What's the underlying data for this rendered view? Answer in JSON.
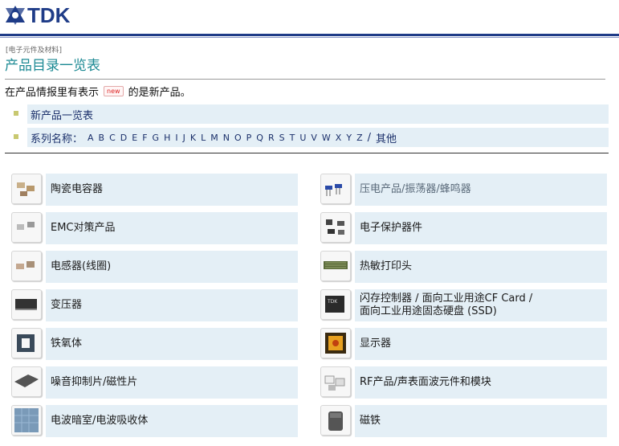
{
  "header": {
    "logo_text": "TDK"
  },
  "breadcrumb": "[电子元件及材料]",
  "page_title": "产品目录一览表",
  "note": {
    "prefix": "在产品情报里有表示",
    "badge": "new",
    "suffix": "的是新产品。"
  },
  "links": {
    "new_list": "新产品一览表",
    "series_label": "系列名称：",
    "letters": [
      "A",
      "B",
      "C",
      "D",
      "E",
      "F",
      "G",
      "H",
      "I",
      "J",
      "K",
      "L",
      "M",
      "N",
      "O",
      "P",
      "Q",
      "R",
      "S",
      "T",
      "U",
      "V",
      "W",
      "X",
      "Y",
      "Z"
    ],
    "others_sep": "/",
    "others": "其他"
  },
  "categories_left": [
    {
      "label": "陶瓷电容器",
      "icon": "ceramic-capacitor-icon"
    },
    {
      "label": "EMC对策产品",
      "icon": "emc-component-icon"
    },
    {
      "label": "电感器(线圈)",
      "icon": "inductor-icon"
    },
    {
      "label": "变压器",
      "icon": "transformer-icon"
    },
    {
      "label": "铁氧体",
      "icon": "ferrite-core-icon"
    },
    {
      "label": "噪音抑制片/磁性片",
      "icon": "noise-sheet-icon"
    },
    {
      "label": "电波暗室/电波吸收体",
      "icon": "anechoic-chamber-icon"
    }
  ],
  "categories_right": [
    {
      "label": "压电产品/振荡器/蜂鸣器",
      "icon": "piezo-icon"
    },
    {
      "label": "电子保护器件",
      "icon": "protection-device-icon"
    },
    {
      "label": "热敏打印头",
      "icon": "thermal-printhead-icon"
    },
    {
      "label": "闪存控制器 / 面向工业用途CF Card /",
      "label2": "面向工业用途固态硬盘 (SSD)",
      "icon": "flash-controller-icon"
    },
    {
      "label": "显示器",
      "icon": "display-icon"
    },
    {
      "label": "RF产品/声表面波元件和模块",
      "icon": "rf-module-icon"
    },
    {
      "label": "磁铁",
      "icon": "magnet-icon"
    }
  ]
}
